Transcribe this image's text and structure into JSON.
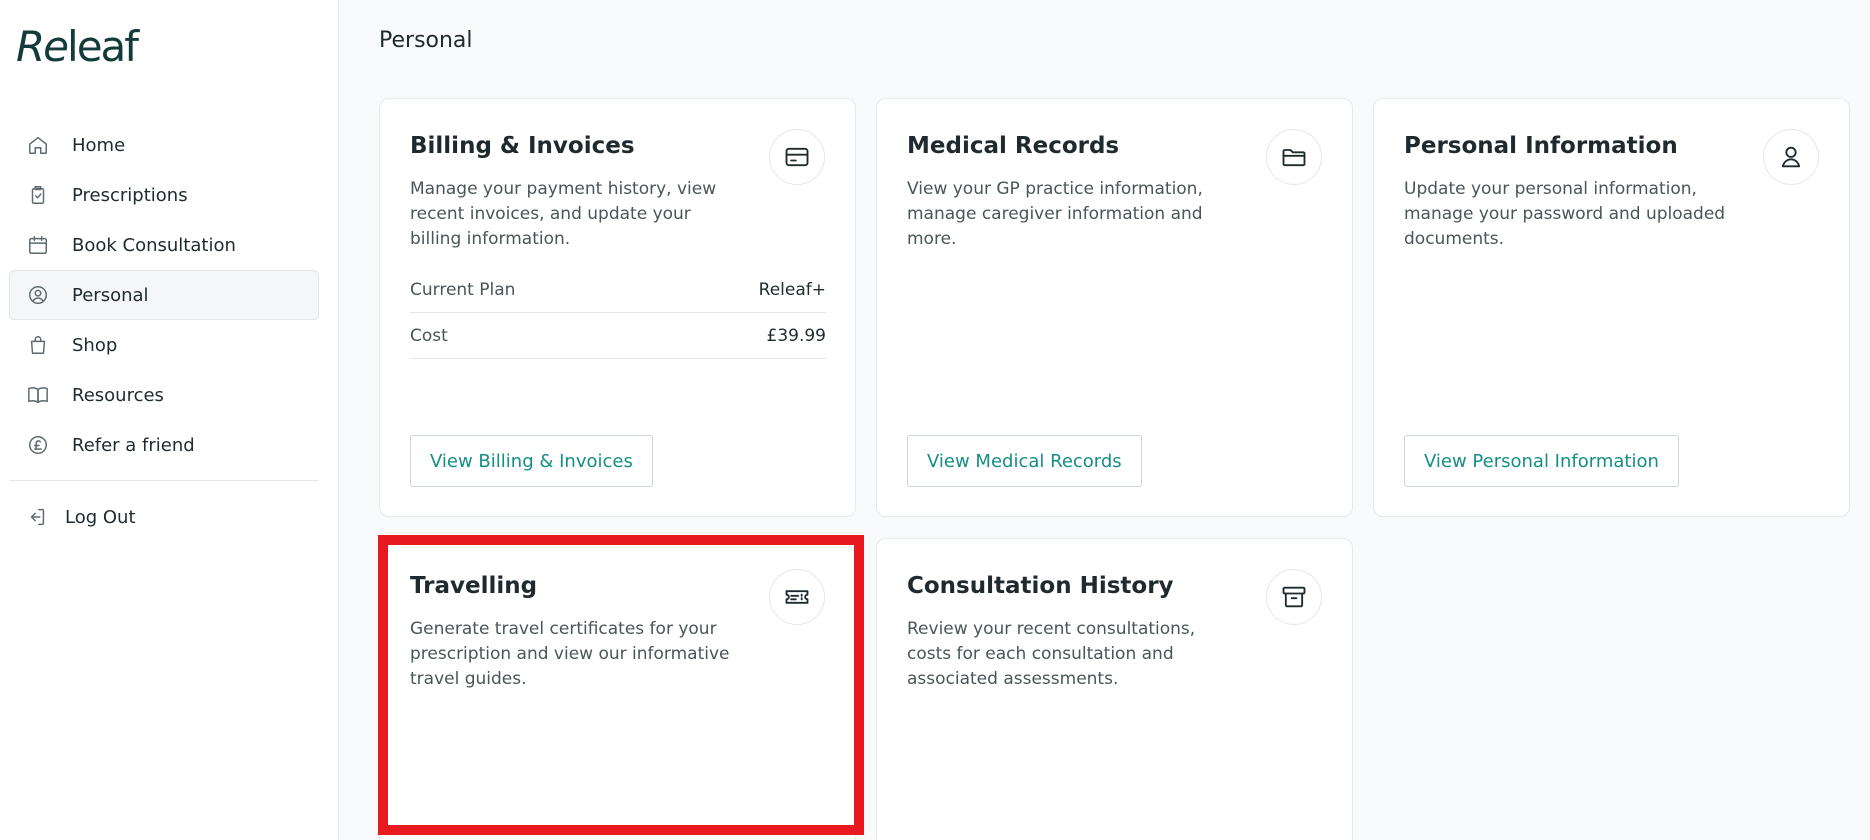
{
  "app": {
    "logo_prefix": "Re",
    "logo_suffix": "leaf"
  },
  "sidebar": {
    "items": [
      {
        "label": "Home",
        "icon": "home-icon"
      },
      {
        "label": "Prescriptions",
        "icon": "prescription-icon"
      },
      {
        "label": "Book Consultation",
        "icon": "calendar-icon"
      },
      {
        "label": "Personal",
        "icon": "user-circle-icon",
        "active": true
      },
      {
        "label": "Shop",
        "icon": "shopping-bag-icon"
      },
      {
        "label": "Resources",
        "icon": "book-icon"
      },
      {
        "label": "Refer a friend",
        "icon": "pound-circle-icon"
      }
    ],
    "logout_label": "Log Out"
  },
  "main": {
    "page_title": "Personal",
    "cards": [
      {
        "title": "Billing & Invoices",
        "description": "Manage your payment history, view recent invoices, and update your billing information.",
        "icon": "credit-card-icon",
        "button": "View Billing & Invoices",
        "plan": {
          "rows": [
            {
              "label": "Current Plan",
              "value": "Releaf+"
            },
            {
              "label": "Cost",
              "value": "£39.99"
            }
          ]
        }
      },
      {
        "title": "Medical Records",
        "description": "View your GP practice information, manage caregiver information and more.",
        "icon": "folder-icon",
        "button": "View Medical Records"
      },
      {
        "title": "Personal Information",
        "description": "Update your personal information, manage your password and uploaded documents.",
        "icon": "user-icon",
        "button": "View Personal Information"
      },
      {
        "title": "Travelling",
        "description": "Generate travel certificates for your prescription and view our informative travel guides.",
        "icon": "ticket-icon"
      },
      {
        "title": "Consultation History",
        "description": "Review your recent consultations, costs for each consultation and associated assessments.",
        "icon": "archive-icon"
      }
    ]
  },
  "colors": {
    "accent": "#158e86",
    "highlight": "#e8191f",
    "background": "#f8fafb"
  }
}
